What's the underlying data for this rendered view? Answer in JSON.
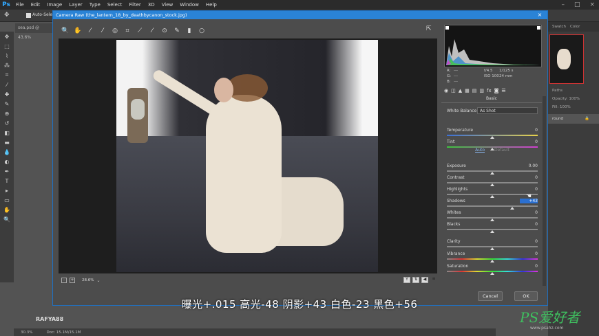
{
  "menubar": {
    "logo": "Ps",
    "items": [
      "File",
      "Edit",
      "Image",
      "Layer",
      "Type",
      "Select",
      "Filter",
      "3D",
      "View",
      "Window",
      "Help"
    ]
  },
  "optbar": {
    "auto_select": "Auto-Select"
  },
  "doc_tab": "sea.psd @ 43.6%",
  "statusbar": {
    "zoom": "30.3%",
    "doc": "Doc: 15.1M/15.1M"
  },
  "right_panel": {
    "tabs": [
      "Swatch",
      "Color"
    ],
    "paths_label": "Paths",
    "opacity_label": "Opacity:",
    "opacity_value": "100%",
    "fill_label": "Fill:",
    "fill_value": "100%",
    "layer_name": "round"
  },
  "dialog": {
    "title": "Camera Raw (the_lantern_18_by_deathbycanon_stock.jpg)",
    "zoom_level": "28.6%",
    "info": {
      "r": "R:",
      "g": "G:",
      "b": "B:",
      "dashes": "---",
      "aperture": "f/4.5",
      "shutter": "1/125 s",
      "iso": "ISO 100",
      "focal": "24 mm"
    },
    "panel_title": "Basic",
    "white_balance_label": "White Balance:",
    "white_balance_value": "As Shot",
    "auto_label": "Auto",
    "default_label": "Default",
    "controls": [
      {
        "label": "Temperature",
        "value": "0",
        "pos": 0.5
      },
      {
        "label": "Tint",
        "value": "0",
        "pos": 0.5
      },
      {
        "label": "Exposure",
        "value": "0.00",
        "pos": 0.5
      },
      {
        "label": "Contrast",
        "value": "0",
        "pos": 0.5
      },
      {
        "label": "Highlights",
        "value": "0",
        "pos": 0.5
      },
      {
        "label": "Shadows",
        "value": "+43",
        "pos": 0.72
      },
      {
        "label": "Whites",
        "value": "0",
        "pos": 0.5
      },
      {
        "label": "Blacks",
        "value": "0",
        "pos": 0.5
      },
      {
        "label": "Clarity",
        "value": "0",
        "pos": 0.5
      },
      {
        "label": "Vibrance",
        "value": "0",
        "pos": 0.5
      },
      {
        "label": "Saturation",
        "value": "0",
        "pos": 0.5
      }
    ],
    "cancel_label": "Cancel",
    "ok_label": "OK"
  },
  "subtitle": "曝光+.015  高光-48  阴影+43  白色-23  黑色+56",
  "watermark": "RAFYA88",
  "site_watermark": "PS爱好者",
  "site_url": "www.psahz.com",
  "colors": {
    "accent": "#2a83d6",
    "bg": "#535353",
    "panel": "#3c3c3c"
  }
}
